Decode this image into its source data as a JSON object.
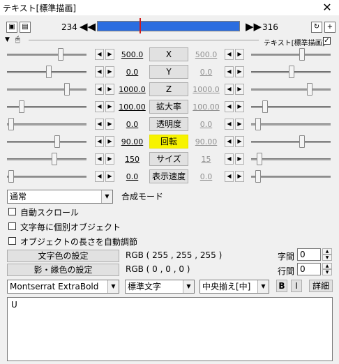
{
  "window": {
    "title": "テキスト[標準描画]",
    "close": "✕"
  },
  "toolbar": {
    "start_frame": "234",
    "end_frame": "316",
    "prev_arrow": "◀◀",
    "next_arrow": "▶▶"
  },
  "header": {
    "label": "テキスト[標準描画]"
  },
  "params": [
    {
      "left": "500.0",
      "name": "X",
      "right": "500.0",
      "highlighted": false
    },
    {
      "left": "0.0",
      "name": "Y",
      "right": "0.0",
      "highlighted": false
    },
    {
      "left": "1000.0",
      "name": "Z",
      "right": "1000.0",
      "highlighted": false
    },
    {
      "left": "100.00",
      "name": "拡大率",
      "right": "100.00",
      "highlighted": false
    },
    {
      "left": "0.0",
      "name": "透明度",
      "right": "0.0",
      "highlighted": false
    },
    {
      "left": "90.00",
      "name": "回転",
      "right": "90.00",
      "highlighted": true
    },
    {
      "left": "150",
      "name": "サイズ",
      "right": "15",
      "highlighted": false
    },
    {
      "left": "0.0",
      "name": "表示速度",
      "right": "0.0",
      "highlighted": false
    }
  ],
  "blend": {
    "value": "通常",
    "label": "合成モード"
  },
  "checks": [
    {
      "label": "自動スクロール"
    },
    {
      "label": "文字毎に個別オブジェクト"
    },
    {
      "label": "オブジェクトの長さを自動調節"
    }
  ],
  "color": {
    "text_btn": "文字色の設定",
    "text_rgb": "RGB ( 255 , 255 , 255 )",
    "shadow_btn": "影・縁色の設定",
    "shadow_rgb": "RGB ( 0 , 0 , 0 )"
  },
  "spacing": {
    "char_label": "字間",
    "char_value": "0",
    "line_label": "行間",
    "line_value": "0"
  },
  "font": {
    "family": "Montserrat ExtraBold",
    "style": "標準文字",
    "align": "中央揃え[中]",
    "bold": "B",
    "italic": "I",
    "detail": "詳細"
  },
  "text": {
    "content": "U"
  },
  "colors": {
    "seek": "#2b6de0",
    "highlight": "#f7f300",
    "marker": "#d01b1b"
  }
}
